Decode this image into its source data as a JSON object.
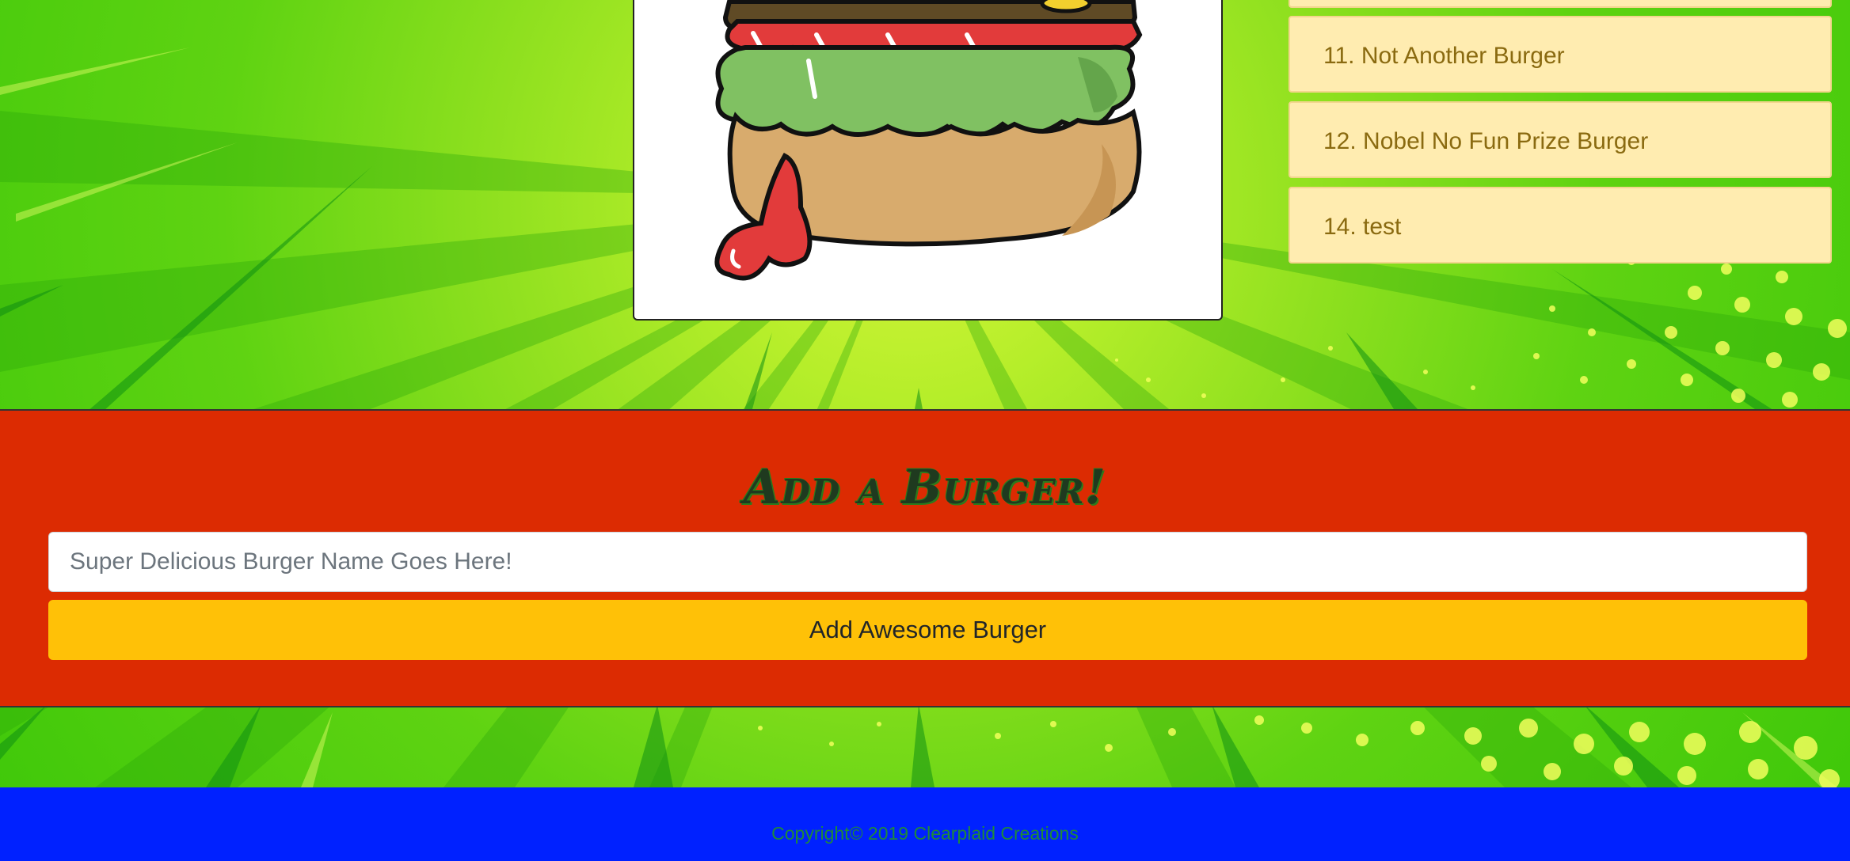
{
  "burger_list": {
    "items": [
      {
        "label": ""
      },
      {
        "label": "11. Not Another Burger"
      },
      {
        "label": "12. Nobel No Fun Prize Burger"
      },
      {
        "label": "14. test"
      }
    ]
  },
  "image": {
    "icon": "burger-illustration"
  },
  "add_form": {
    "title": "Add a Burger!",
    "input_placeholder": "Super Delicious Burger Name Goes Here!",
    "input_value": "",
    "button_label": "Add Awesome Burger"
  },
  "footer": {
    "copyright": "Copyright© 2019 Clearplaid Creations"
  },
  "colors": {
    "form_bg": "#dc2b02",
    "button": "#ffc107",
    "footer_bg": "#0021ff",
    "list_item_bg": "#ffecb0",
    "list_item_text": "#8a6a10"
  }
}
